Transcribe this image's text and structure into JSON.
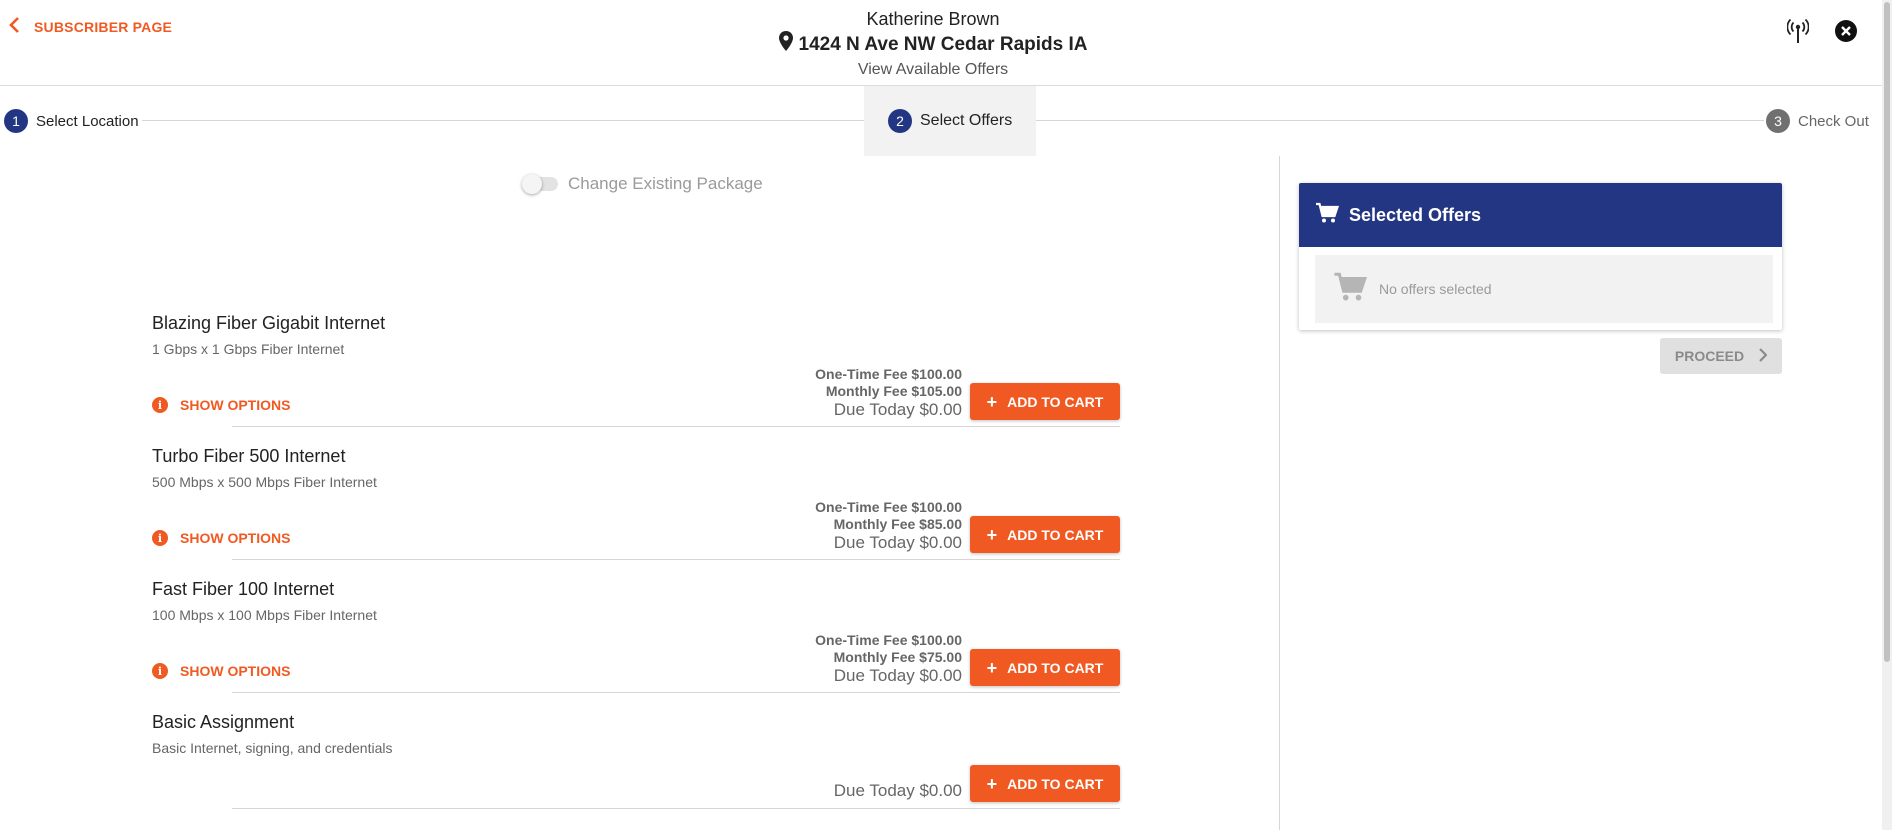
{
  "header": {
    "back_label": "SUBSCRIBER PAGE",
    "subscriber_name": "Katherine Brown",
    "address": "1424 N Ave NW Cedar Rapids IA",
    "subtitle": "View Available Offers",
    "icons": [
      "back-chevron-icon",
      "location-pin-icon",
      "antenna-icon",
      "close-circle-icon"
    ]
  },
  "stepper": {
    "steps": [
      {
        "number": "1",
        "label": "Select Location",
        "state": "complete"
      },
      {
        "number": "2",
        "label": "Select Offers",
        "state": "active"
      },
      {
        "number": "3",
        "label": "Check Out",
        "state": "upcoming"
      }
    ]
  },
  "toggle": {
    "label": "Change Existing Package",
    "checked": false
  },
  "offers": [
    {
      "name": "Blazing Fiber Gigabit Internet",
      "description": "1 Gbps x 1 Gbps Fiber Internet",
      "show_options": "SHOW OPTIONS",
      "one_time_fee": "One-Time Fee $100.00",
      "monthly_fee": "Monthly Fee $105.00",
      "due_today": "Due Today $0.00",
      "add_label": "ADD TO CART"
    },
    {
      "name": "Turbo Fiber 500 Internet",
      "description": "500 Mbps x 500 Mbps Fiber Internet",
      "show_options": "SHOW OPTIONS",
      "one_time_fee": "One-Time Fee $100.00",
      "monthly_fee": "Monthly Fee $85.00",
      "due_today": "Due Today $0.00",
      "add_label": "ADD TO CART"
    },
    {
      "name": "Fast Fiber 100 Internet",
      "description": "100 Mbps x 100 Mbps Fiber Internet",
      "show_options": "SHOW OPTIONS",
      "one_time_fee": "One-Time Fee $100.00",
      "monthly_fee": "Monthly Fee $75.00",
      "due_today": "Due Today $0.00",
      "add_label": "ADD TO CART"
    },
    {
      "name": "Basic Assignment",
      "description": "Basic Internet, signing, and credentials",
      "due_today": "Due Today $0.00",
      "add_label": "ADD TO CART"
    }
  ],
  "selected_offers": {
    "title": "Selected Offers",
    "empty_text": "No offers selected",
    "proceed_label": "PROCEED"
  },
  "colors": {
    "accent": "#f05a22",
    "primary": "#233683",
    "muted": "#9a9a9a",
    "divider": "#d6d6d6"
  }
}
